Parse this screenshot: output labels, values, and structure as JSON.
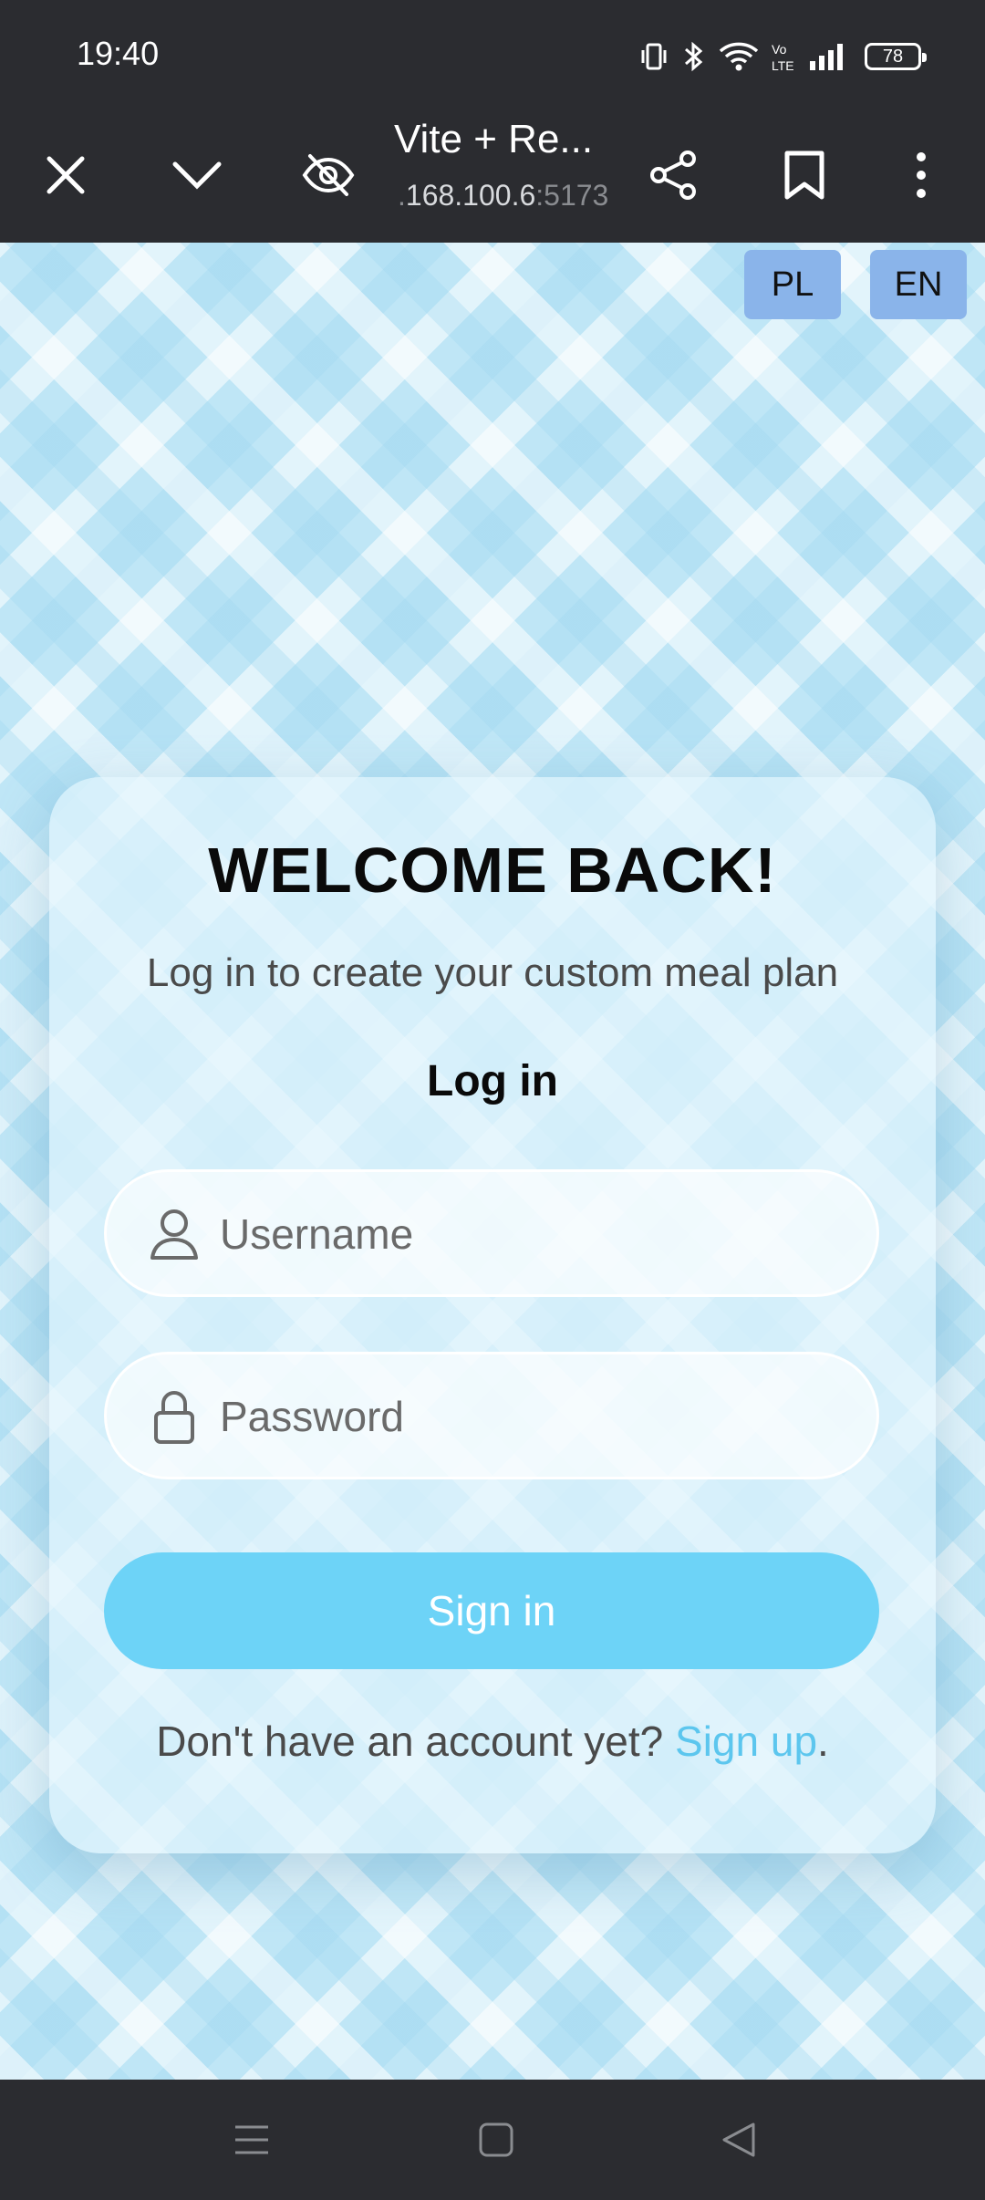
{
  "status": {
    "time": "19:40",
    "battery": "78"
  },
  "browser": {
    "title": "Vite + Re...",
    "url_prefix": ".",
    "url_main": "168.100.6",
    "url_port": ":5173"
  },
  "lang": {
    "pl": "PL",
    "en": "EN"
  },
  "card": {
    "title": "WELCOME BACK!",
    "subtitle": "Log in to create your custom meal plan",
    "heading": "Log in",
    "username_placeholder": "Username",
    "password_placeholder": "Password",
    "signin_label": "Sign in",
    "signup_prompt": "Don't have an account yet? ",
    "signup_link": "Sign up",
    "signup_period": "."
  },
  "colors": {
    "accent": "#6dd3f7",
    "link": "#5cc6ee",
    "lang_button": "#8ab4ea",
    "chrome": "#2b2c30"
  },
  "icons": [
    "vibrate-icon",
    "bluetooth-icon",
    "wifi-icon",
    "volte-icon",
    "signal-icon",
    "battery-icon",
    "close-icon",
    "chevron-down-icon",
    "eye-off-icon",
    "share-icon",
    "bookmark-icon",
    "more-vert-icon",
    "user-icon",
    "lock-icon",
    "menu-icon",
    "home-icon",
    "back-icon"
  ]
}
